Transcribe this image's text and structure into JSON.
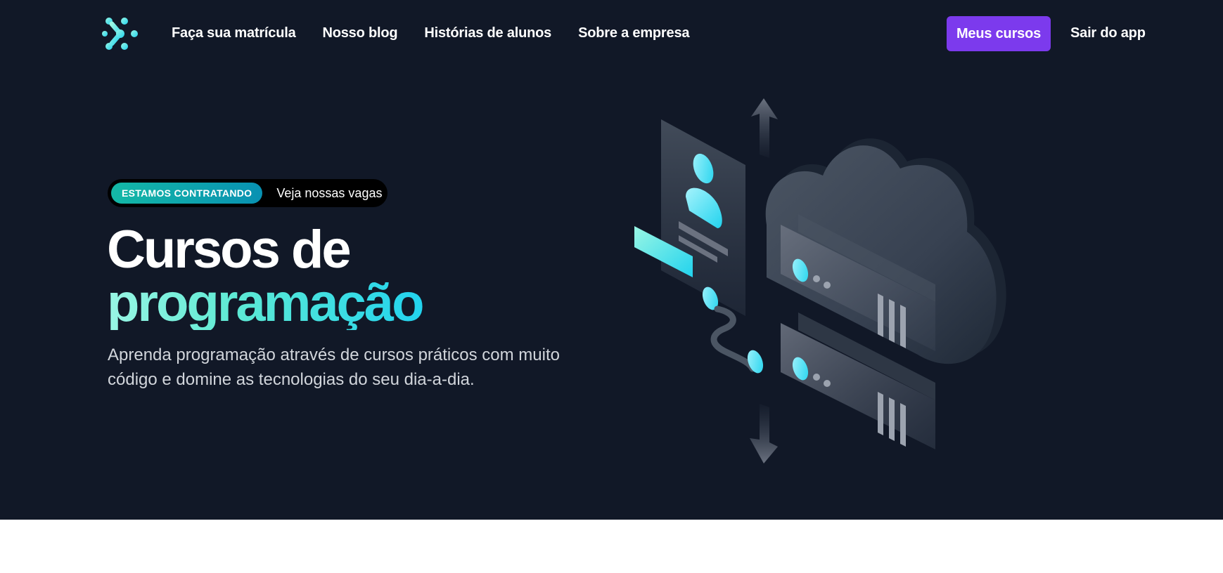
{
  "nav": {
    "links": [
      {
        "label": "Faça sua matrícula"
      },
      {
        "label": "Nosso blog"
      },
      {
        "label": "Histórias de alunos"
      },
      {
        "label": "Sobre a empresa"
      }
    ],
    "my_courses_label": "Meus cursos",
    "logout_label": "Sair do app"
  },
  "hero": {
    "badge_tag": "ESTAMOS CONTRATANDO",
    "badge_text": "Veja nossas vagas",
    "title_line1": "Cursos de",
    "title_line2": "programação",
    "subtitle": "Aprenda programação através de cursos práticos com muito código e domine as tecnologias do seu dia-a-dia."
  },
  "colors": {
    "background": "#111827",
    "accent_purple": "#7c3aed",
    "accent_teal": "#5eead4",
    "accent_cyan": "#22d3ee"
  },
  "icons": {
    "logo": "brand-logo-icon",
    "badge_chevron": "chevron-right-icon",
    "illustration": "cloud-servers-illustration"
  }
}
